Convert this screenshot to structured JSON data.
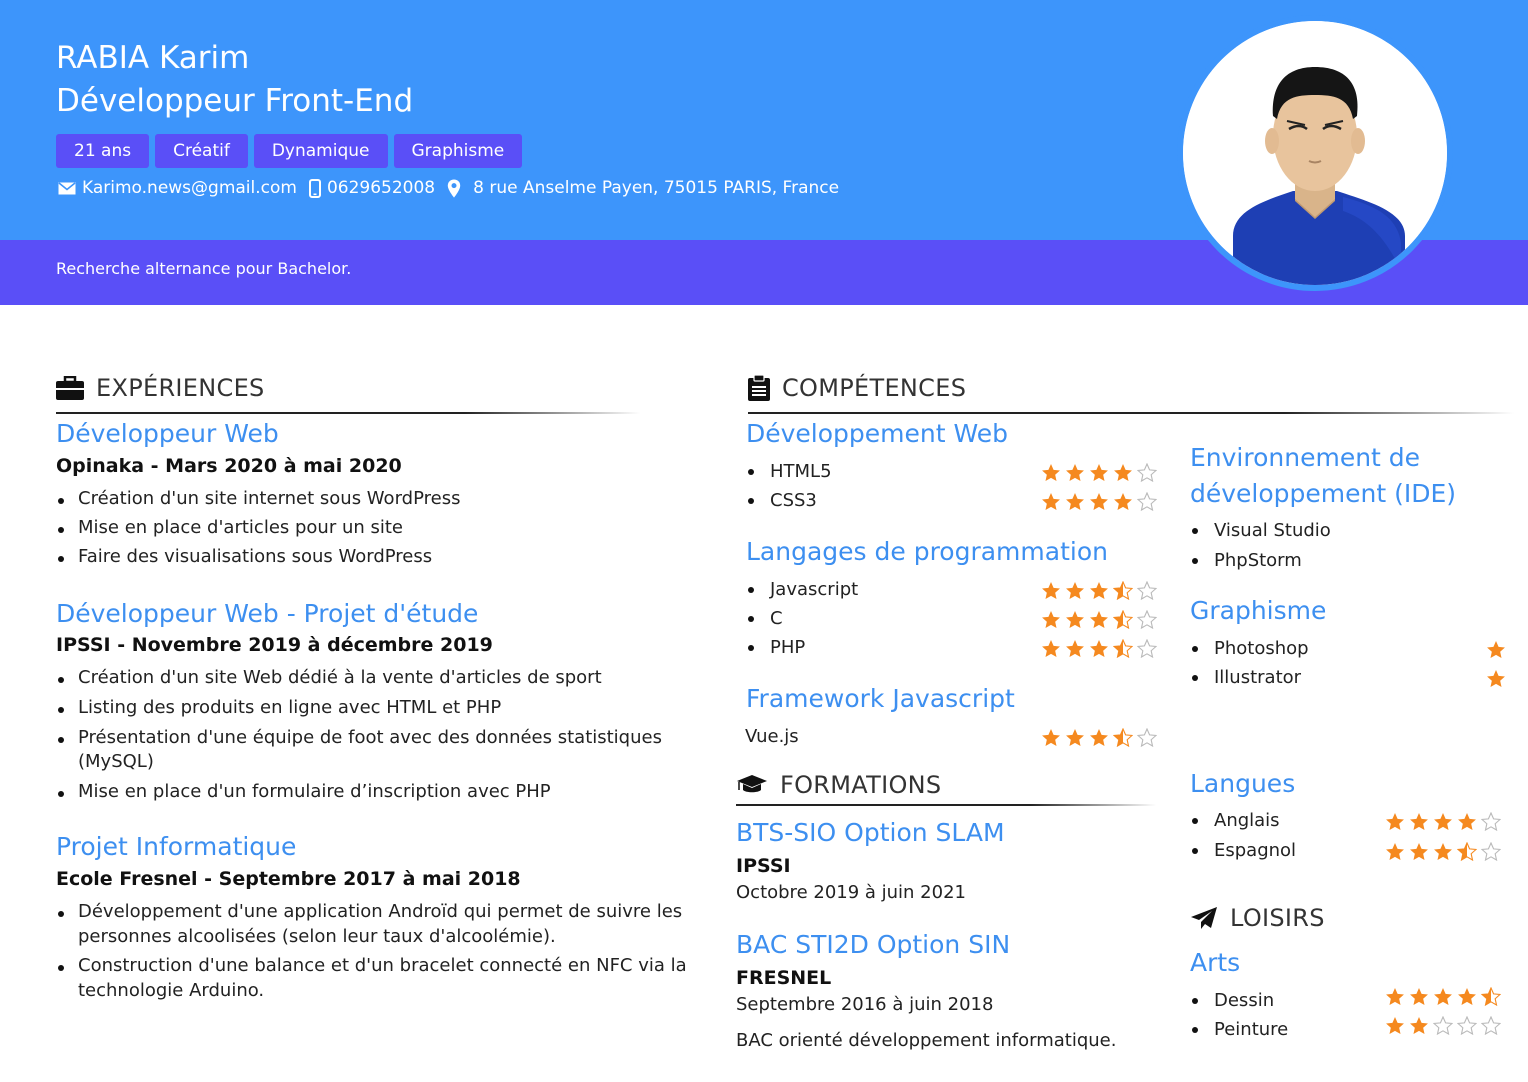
{
  "header": {
    "name": "RABIA Karim",
    "title": "Développeur Front-End",
    "tags": [
      "21 ans",
      "Créatif",
      "Dynamique",
      "Graphisme"
    ],
    "email": "Karimo.news@gmail.com",
    "phone": "0629652008",
    "address": "8 rue Anselme Payen, 75015 PARIS, France",
    "pitch": "Recherche alternance pour Bachelor."
  },
  "colors": {
    "header_bg": "#3d95fb",
    "band_bg": "#5a4ff7",
    "accent_text": "#3d8ff0",
    "star": "#f5891f"
  },
  "experiences": {
    "heading": "EXPÉRIENCES",
    "items": [
      {
        "title": "Développeur Web",
        "subtitle": "Opinaka - Mars 2020 à mai 2020",
        "bullets": [
          "Création d'un site internet sous WordPress",
          "Mise en place d'articles pour un site",
          "Faire des visualisations sous WordPress"
        ]
      },
      {
        "title": "Développeur Web - Projet d'étude",
        "subtitle": "IPSSI - Novembre 2019 à décembre 2019",
        "bullets": [
          "Création d'un site Web dédié à la vente d'articles de sport",
          "Listing des produits en ligne avec HTML et PHP",
          "Présentation d'une équipe de foot avec des données statistiques",
          "(MySQL)",
          "Mise en place d'un formulaire d’inscription avec PHP"
        ]
      },
      {
        "title": "Projet Informatique",
        "subtitle": "Ecole Fresnel - Septembre 2017 à mai 2018",
        "bullets": [
          "Développement d'une application Androïd qui permet de suivre les",
          "personnes alcoolisées (selon leur taux d'alcoolémie).",
          "Construction d'une balance et d'un bracelet connecté en NFC via la",
          "technologie Arduino."
        ]
      }
    ]
  },
  "competences": {
    "heading": "COMPÉTENCES",
    "web": {
      "title": "Développement Web",
      "items": [
        {
          "name": "HTML5",
          "rating": 4
        },
        {
          "name": "CSS3",
          "rating": 4
        }
      ]
    },
    "langs": {
      "title": "Langages de programmation",
      "items": [
        {
          "name": "Javascript",
          "rating": 3.5
        },
        {
          "name": "C",
          "rating": 3.5
        },
        {
          "name": "PHP",
          "rating": 3.5
        }
      ]
    },
    "framework": {
      "title": "Framework Javascript",
      "items": [
        {
          "name": "Vue.js",
          "rating": 3.5
        }
      ]
    },
    "ide": {
      "title_line1": "Environnement de",
      "title_line2": "développement (IDE)",
      "items": [
        "Visual Studio",
        "PhpStorm"
      ]
    },
    "graphisme": {
      "title": "Graphisme",
      "items": [
        {
          "name": "Photoshop",
          "rating": 1
        },
        {
          "name": "Illustrator",
          "rating": 1
        }
      ]
    },
    "langues": {
      "title": "Langues",
      "items": [
        {
          "name": "Anglais",
          "rating": 4
        },
        {
          "name": "Espagnol",
          "rating": 3.5
        }
      ]
    }
  },
  "formations": {
    "heading": "FORMATIONS",
    "items": [
      {
        "title": "BTS-SIO Option SLAM",
        "school": "IPSSI",
        "dates": "Octobre 2019 à juin 2021"
      },
      {
        "title": "BAC STI2D Option SIN",
        "school": "FRESNEL",
        "dates": "Septembre 2016 à juin 2018",
        "note": "BAC orienté développement informatique."
      }
    ]
  },
  "loisirs": {
    "heading": "LOISIRS",
    "arts": {
      "title": "Arts",
      "items": [
        {
          "name": "Dessin",
          "rating": 4.5
        },
        {
          "name": "Peinture",
          "rating": 2
        }
      ]
    }
  }
}
